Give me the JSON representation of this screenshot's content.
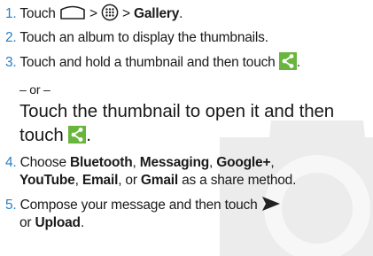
{
  "steps": [
    {
      "num": "1.",
      "t1": "Touch",
      "t2": ">",
      "t3": ">",
      "bold": "Gallery",
      "t4": "."
    },
    {
      "num": "2.",
      "text": "Touch an album to display the thumbnails."
    },
    {
      "num": "3.",
      "text": "Touch and hold a thumbnail and then touch",
      "end": "."
    },
    {
      "num": "4.",
      "line1": "Choose",
      "opts": [
        "Bluetooth",
        "Messaging",
        "Google+",
        "YouTube",
        "Email",
        "Gmail"
      ],
      "sep": ",",
      "or": ", or",
      "tail": "as a share method."
    },
    {
      "num": "5.",
      "line1": "Compose your message and then touch",
      "or": "or",
      "bold": "Upload",
      "end": "."
    }
  ],
  "or_divider": "– or –",
  "alt": {
    "line1": "Touch the thumbnail to open it and then",
    "line2": "touch",
    "end": "."
  },
  "icons": [
    "home-icon",
    "apps-icon",
    "share-icon",
    "send-icon",
    "camera-icon"
  ],
  "colors": {
    "number": "#2a7fc2",
    "share": "#69b53e",
    "text": "#1a1a1a",
    "watermark": "#ececec"
  }
}
